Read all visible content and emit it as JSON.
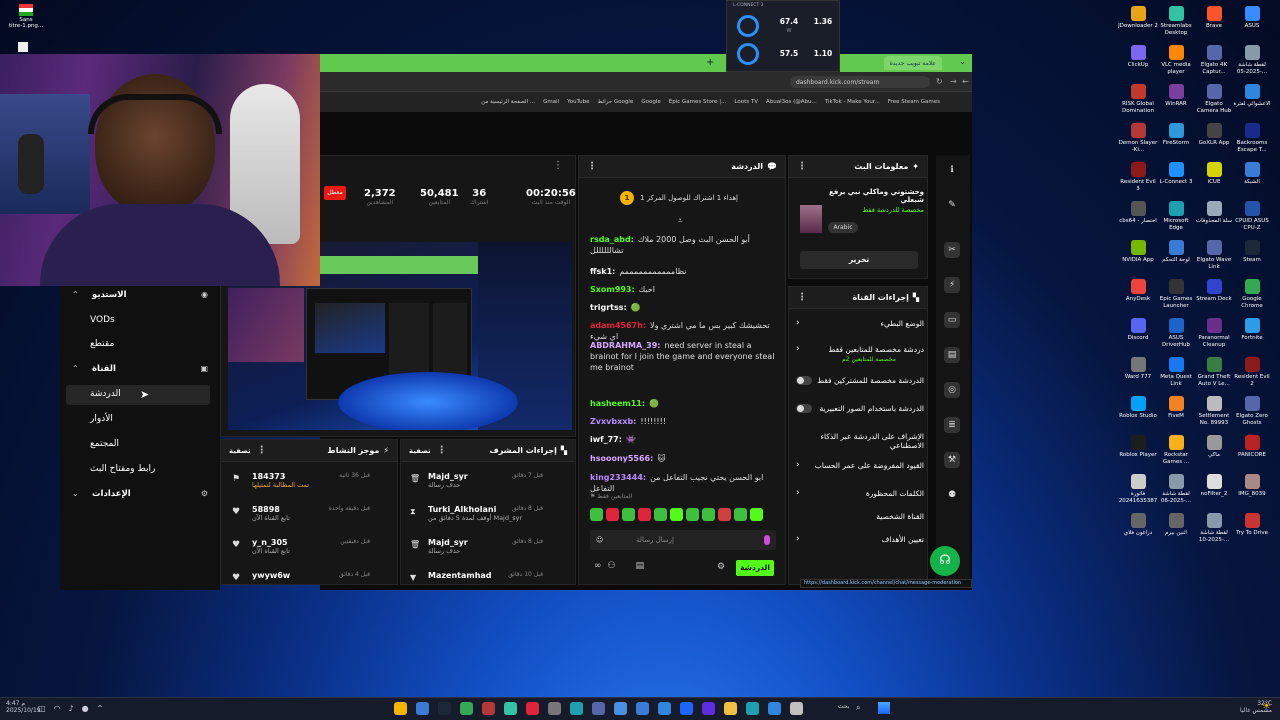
{
  "desktop_left": {
    "top_item": "Sans\ntitre-1.png..."
  },
  "desktop_right": [
    {
      "label": "JDownloader 2",
      "color": "#e8a317"
    },
    {
      "label": "Streamlabs Desktop",
      "color": "#31c3a2"
    },
    {
      "label": "Brave",
      "color": "#fb542b"
    },
    {
      "label": "ASUS",
      "color": "#3a8bff"
    },
    {
      "label": "ClickUp",
      "color": "#7b68ee"
    },
    {
      "label": "VLC media player",
      "color": "#ff8800"
    },
    {
      "label": "Elgato 4K Captur...",
      "color": "#5566aa"
    },
    {
      "label": "لقطة شاشة 2025-05-...",
      "color": "#8899aa"
    },
    {
      "label": "RISK Global Domination",
      "color": "#c0392b"
    },
    {
      "label": "WinRAR",
      "color": "#7a3fa0"
    },
    {
      "label": "Elgato Camera Hub",
      "color": "#5566aa"
    },
    {
      "label": "الأعشوائي لفترة",
      "color": "#2e86de"
    },
    {
      "label": "Demon Slayer -Ki...",
      "color": "#b33939"
    },
    {
      "label": "FireStorm",
      "color": "#2d98da"
    },
    {
      "label": "GoXLR App",
      "color": "#444"
    },
    {
      "label": "Backrooms Escape T...",
      "color": "#1a2a8a"
    },
    {
      "label": "Resident Evil 3",
      "color": "#8b1a1a"
    },
    {
      "label": "L-Connect 3",
      "color": "#1e90ff"
    },
    {
      "label": "iCUE",
      "color": "#d4d400"
    },
    {
      "label": "الشبكة",
      "color": "#3a7bd5"
    },
    {
      "label": "cbs64 - اختصار",
      "color": "#555"
    },
    {
      "label": "Microsoft Edge",
      "color": "#1fa0b0"
    },
    {
      "label": "سلة المحذوفات",
      "color": "#9ab"
    },
    {
      "label": "CPUID ASUS CPU-Z",
      "color": "#2255aa"
    },
    {
      "label": "NVIDIA App",
      "color": "#76b900"
    },
    {
      "label": "لوحة التحكم",
      "color": "#3a7bd5"
    },
    {
      "label": "Elgato Wave Link",
      "color": "#5566aa"
    },
    {
      "label": "Steam",
      "color": "#1b2838"
    },
    {
      "label": "AnyDesk",
      "color": "#ef443b"
    },
    {
      "label": "Epic Games Launcher",
      "color": "#333"
    },
    {
      "label": "Stream Deck",
      "color": "#3344cc"
    },
    {
      "label": "Google Chrome",
      "color": "#34a853"
    },
    {
      "label": "Discord",
      "color": "#5865f2"
    },
    {
      "label": "ASUS DriverHub",
      "color": "#1e64c8"
    },
    {
      "label": "Paranormal Cleanup",
      "color": "#6b2e8a"
    },
    {
      "label": "Fortnite",
      "color": "#2e9be6"
    },
    {
      "label": "Ward 777",
      "color": "#777"
    },
    {
      "label": "Meta Quest Link",
      "color": "#1877f2"
    },
    {
      "label": "Grand Theft Auto V Le...",
      "color": "#3a7d44"
    },
    {
      "label": "Resident Evil 2",
      "color": "#8b1a1a"
    },
    {
      "label": "Roblox Studio",
      "color": "#00a2ff"
    },
    {
      "label": "FiveM",
      "color": "#f58220"
    },
    {
      "label": "Settlement No. 89993",
      "color": "#bbb"
    },
    {
      "label": "Elgato Zero Ghosts",
      "color": "#5566aa"
    },
    {
      "label": "Roblox Player",
      "color": "#1d1d1d"
    },
    {
      "label": "Rockstar Games ...",
      "color": "#fcaf17"
    },
    {
      "label": "ماكي",
      "color": "#999"
    },
    {
      "label": "PANICORE",
      "color": "#b22"
    },
    {
      "label": "فاتورة 20241635387",
      "color": "#ccc"
    },
    {
      "label": "لقطة شاشة 2025-06-...",
      "color": "#8899aa"
    },
    {
      "label": "noFilter_2",
      "color": "#ddd"
    },
    {
      "label": "IMG_8039",
      "color": "#a88"
    },
    {
      "label": "دراغون فلاي",
      "color": "#666"
    },
    {
      "label": "اثنين بيرم",
      "color": "#666"
    },
    {
      "label": "لقطة شاشة 2025-10-...",
      "color": "#8899aa"
    },
    {
      "label": "Try To Drive",
      "color": "#c33"
    }
  ],
  "overlay": {
    "val1": "67.4",
    "val2": "1.36",
    "val3": "57.5",
    "val4": "1.10",
    "unit": "W",
    "title": "L-CONNECT 3"
  },
  "browser": {
    "tab_label": "علامة تبويب جديدة",
    "url": "dashboard.kick.com/stream",
    "bookmarks": [
      "Free Steam Games",
      "TikTok - Make Your...",
      "Abual3os (@Abu...",
      "Loots TV",
      "Epic Games Store |...",
      "Google",
      "حرائط Google",
      "YouTube",
      "Gmail",
      "الصفحة الرئيسية من ..."
    ]
  },
  "nav": {
    "studio": "الاستديو",
    "vods": "VODs",
    "clips": "مقتطع",
    "channel": "القناة",
    "chat": "الدردشة",
    "roles": "الأدوار",
    "community": "المجتمع",
    "stream_key": "رابط ومفتاح البث",
    "settings": "الإعدادات"
  },
  "stats": {
    "live_badge": "معطل",
    "viewers": "2,372",
    "viewers_label": "المشاهدين",
    "followers": "50,481",
    "followers_label": "المتابعين",
    "subs": "36",
    "subs_label": "اشتراك",
    "uptime": "00:20:56",
    "uptime_label": "الوقت منذ البث"
  },
  "chat": {
    "title": "الدردشة",
    "pinned": "إهداء 1 اشتراك للوصول المركز 1",
    "messages": [
      {
        "user": "rsda_abd:",
        "color": "#53fc18",
        "text": "أبو الحسن البث وصل 2000 ملاك تشاللللللل"
      },
      {
        "user": "ffsk1:",
        "color": "#ffffff",
        "text": "نظامممممممممممم"
      },
      {
        "user": "Sxom993:",
        "color": "#53fc18",
        "text": "احبك"
      },
      {
        "user": "trigrtss:",
        "color": "#ffffff",
        "text": "🟢"
      },
      {
        "user": "adam4567h:",
        "color": "#e0243a",
        "text": "تحشيشك كبير بس ما مي اشتري ولا اي شيء"
      },
      {
        "user": "ABDRAHMA_39:",
        "color": "#d9a7ff",
        "text": "need server in steal a brainot for I join the game and everyone steal me brainot"
      },
      {
        "user": "hasheem11:",
        "color": "#53fc18",
        "text": "🟢"
      },
      {
        "user": "Zvxvbxxb:",
        "color": "#b98bff",
        "text": "!!!!!!!!"
      },
      {
        "user": "iwf_77:",
        "color": "#ffffff",
        "text": "👾"
      },
      {
        "user": "hsooony5566:",
        "color": "#d9a7ff",
        "text": "🐱"
      },
      {
        "user": "king233444:",
        "color": "#b98bff",
        "text": "ابو الحسن يحتي نجيب التفاعل من التفاعل"
      }
    ],
    "followers_only": "المتابعين فقط",
    "input_placeholder": "إرسال رسالة",
    "send_button": "الدردشة"
  },
  "stream_info": {
    "title": "معلومات البث",
    "stream_title": "وحشتوني وماكلي نبي برفع شبعلي",
    "category_line": "مخصصة للدردشة فقط",
    "language": "Arabic",
    "edit_button": "تحرير"
  },
  "channel_actions": {
    "title": "إجراءات القناة",
    "items": [
      "الوضع البطيء",
      "دردشة مخصصة للمتابعين فقط",
      "الدردشة مخصصة للمشتركين فقط",
      "الدردشة باستخدام الصور التعبيرية",
      "الإشراف على الدردشة عبر الذكاء الاصطناعي",
      "القيود المفروضة على عمر الحساب",
      "الكلمات المحظورة",
      "القناة الشخصية",
      "تعيين الأهداف"
    ],
    "slow_mode_sub": "مخصصة للمتابعين 2م",
    "status_url": "https://dashboard.kick.com/channel/chat/message-moderation"
  },
  "activity": {
    "title": "موجز النشاط",
    "filter": "تصفية",
    "rows": [
      {
        "name": "184373",
        "sub": "تمت المطالبة لتمثيلها",
        "time": "قبل 36 ثانية"
      },
      {
        "name": "58898",
        "sub": "تابع القناة الآن",
        "time": "قبل دقيقة واحدة"
      },
      {
        "name": "y_n_305",
        "sub": "تابع القناة الآن",
        "time": "قبل دقيقتين"
      },
      {
        "name": "ywyw6w",
        "sub": "",
        "time": "قبل 4 دقائق"
      }
    ]
  },
  "mod_actions": {
    "title": "إجراءات المشرف",
    "filter": "تصفية",
    "rows": [
      {
        "name": "Majd_syr",
        "sub": "حذف رسالة",
        "time": "قبل 7 دقائق"
      },
      {
        "name": "Turki_Alkholani",
        "sub": "أوقف لمدة 5 دقائق من Majd_syr",
        "time": "قبل 8 دقائق"
      },
      {
        "name": "Majd_syr",
        "sub": "حذف رسالة",
        "time": "قبل 8 دقائق"
      },
      {
        "name": "Mazentamhad",
        "sub": "",
        "time": "قبل 10 دقائق"
      }
    ]
  },
  "taskbar": {
    "clock_time": "4:47 م",
    "clock_date": "2025/10/19",
    "weather": "32°C",
    "weather_sub": "مشمس غالبا",
    "search": "بحث"
  }
}
